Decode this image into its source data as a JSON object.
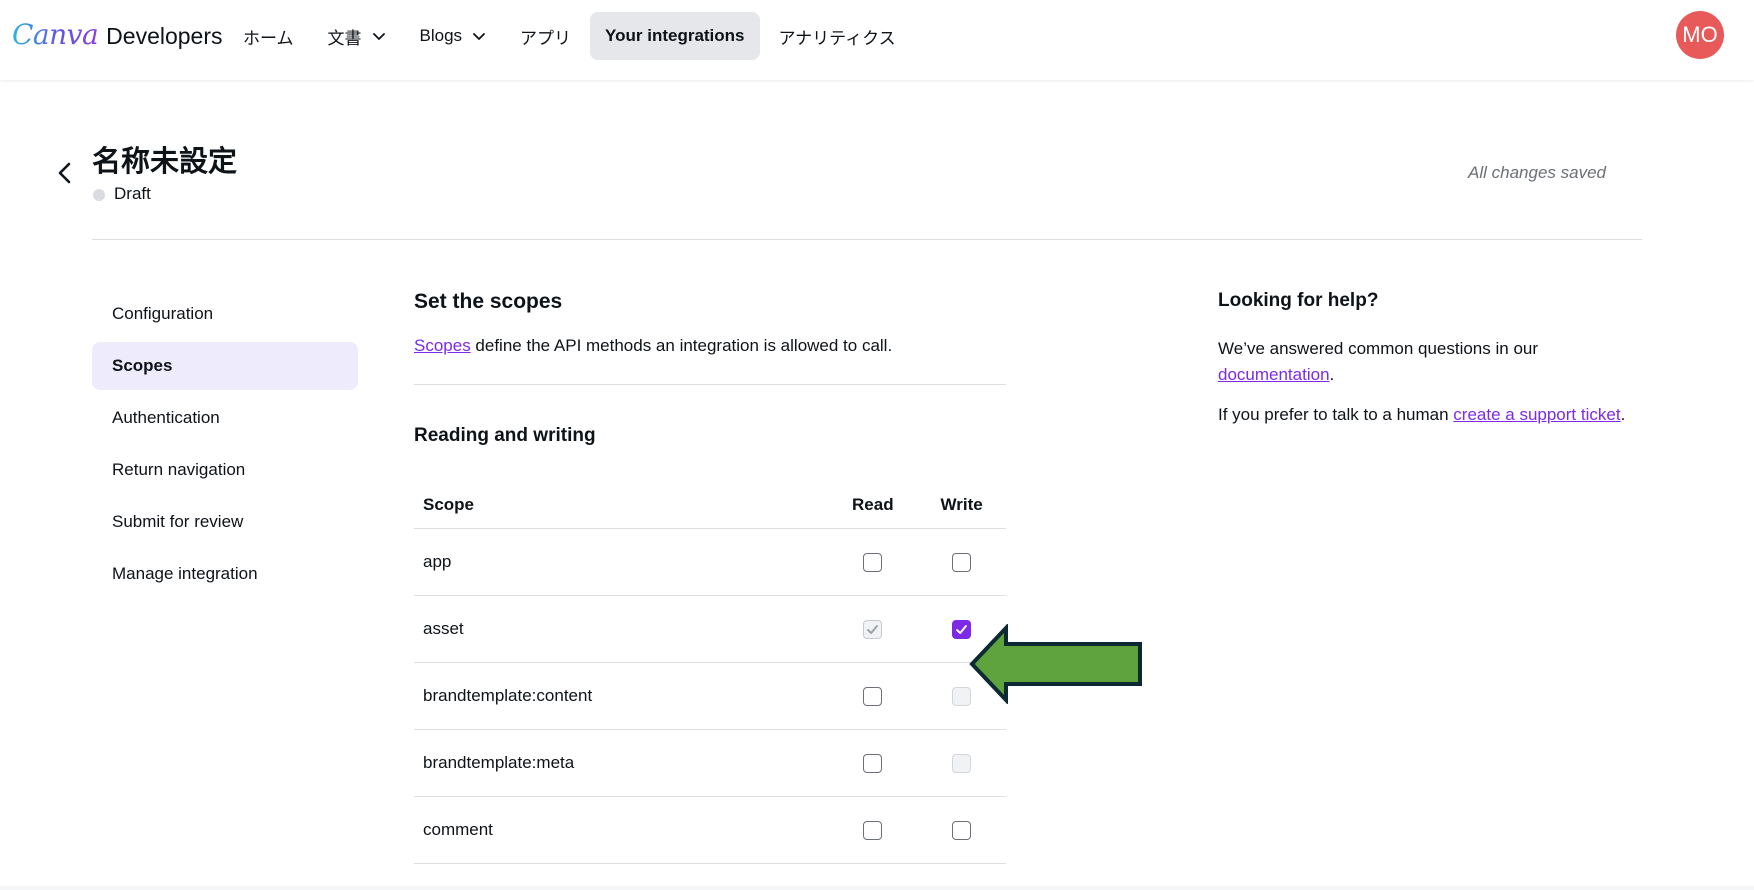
{
  "brand": {
    "logo": "Canva",
    "product": "Developers"
  },
  "nav": {
    "items": [
      {
        "label": "ホーム",
        "dropdown": false,
        "active": false
      },
      {
        "label": "文書",
        "dropdown": true,
        "active": false
      },
      {
        "label": "Blogs",
        "dropdown": true,
        "active": false
      },
      {
        "label": "アプリ",
        "dropdown": false,
        "active": false
      },
      {
        "label": "Your integrations",
        "dropdown": false,
        "active": true
      },
      {
        "label": "アナリティクス",
        "dropdown": false,
        "active": false
      }
    ],
    "avatar_initials": "MO",
    "avatar_color": "#e85a5a"
  },
  "header": {
    "title": "名称未設定",
    "status": "Draft",
    "save_state": "All changes saved"
  },
  "sidebar": {
    "items": [
      {
        "label": "Configuration",
        "active": false
      },
      {
        "label": "Scopes",
        "active": true
      },
      {
        "label": "Authentication",
        "active": false
      },
      {
        "label": "Return navigation",
        "active": false
      },
      {
        "label": "Submit for review",
        "active": false
      },
      {
        "label": "Manage integration",
        "active": false
      }
    ]
  },
  "main": {
    "heading": "Set the scopes",
    "desc_link": "Scopes",
    "desc_rest": " define the API methods an integration is allowed to call.",
    "section_heading": "Reading and writing",
    "table": {
      "headers": {
        "scope": "Scope",
        "read": "Read",
        "write": "Write"
      },
      "rows": [
        {
          "scope": "app",
          "read": "unchecked",
          "write": "unchecked"
        },
        {
          "scope": "asset",
          "read": "checked-disabled",
          "write": "checked"
        },
        {
          "scope": "brandtemplate:content",
          "read": "unchecked",
          "write": "disabled"
        },
        {
          "scope": "brandtemplate:meta",
          "read": "unchecked",
          "write": "disabled"
        },
        {
          "scope": "comment",
          "read": "unchecked",
          "write": "unchecked"
        }
      ]
    }
  },
  "help": {
    "heading": "Looking for help?",
    "p1_text": "We’ve answered common questions in our ",
    "p1_link": "documentation",
    "p1_end": ".",
    "p2_text": "If you prefer to talk to a human ",
    "p2_link": "create a support ticket",
    "p2_end": "."
  },
  "colors": {
    "accent": "#7d2ae8",
    "active_nav_bg": "#e6e7ea",
    "active_side_bg": "#eeebfd",
    "arrow_fill": "#5fa33f",
    "arrow_stroke": "#0d2a33"
  }
}
